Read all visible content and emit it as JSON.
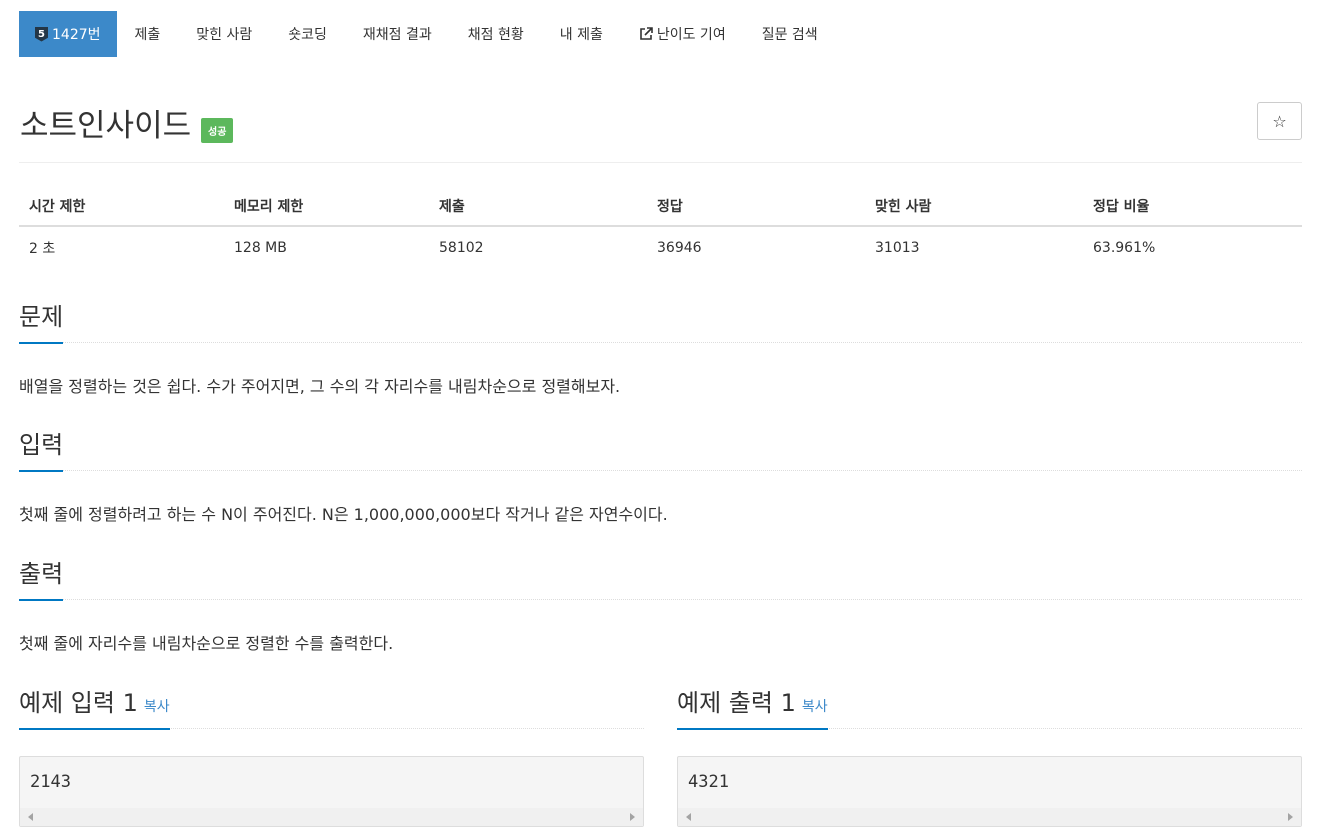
{
  "tabs": [
    {
      "label": "1427번",
      "tier": "5",
      "active": true
    },
    {
      "label": "제출"
    },
    {
      "label": "맞힌 사람"
    },
    {
      "label": "숏코딩"
    },
    {
      "label": "재채점 결과"
    },
    {
      "label": "채점 현황"
    },
    {
      "label": "내 제출"
    },
    {
      "label": "난이도 기여",
      "icon": "external-link-icon"
    },
    {
      "label": "질문 검색"
    }
  ],
  "problem": {
    "title": "소트인사이드",
    "status_badge": "성공",
    "star_icon": "☆"
  },
  "info_table": {
    "headers": [
      "시간 제한",
      "메모리 제한",
      "제출",
      "정답",
      "맞힌 사람",
      "정답 비율"
    ],
    "values": [
      "2 초",
      "128 MB",
      "58102",
      "36946",
      "31013",
      "63.961%"
    ]
  },
  "sections": {
    "description": {
      "heading": "문제",
      "text": "배열을 정렬하는 것은 쉽다. 수가 주어지면, 그 수의 각 자리수를 내림차순으로 정렬해보자."
    },
    "input": {
      "heading": "입력",
      "text": "첫째 줄에 정렬하려고 하는 수 N이 주어진다. N은 1,000,000,000보다 작거나 같은 자연수이다."
    },
    "output": {
      "heading": "출력",
      "text": "첫째 줄에 자리수를 내림차순으로 정렬한 수를 출력한다."
    }
  },
  "samples": {
    "input": {
      "heading": "예제 입력 1",
      "copy_label": "복사",
      "content": "2143"
    },
    "output": {
      "heading": "예제 출력 1",
      "copy_label": "복사",
      "content": "4321"
    }
  },
  "colors": {
    "accent": "#3c89c9",
    "success": "#5cb85c",
    "heading_underline": "#0078c3",
    "tier_badge": "#243646"
  }
}
